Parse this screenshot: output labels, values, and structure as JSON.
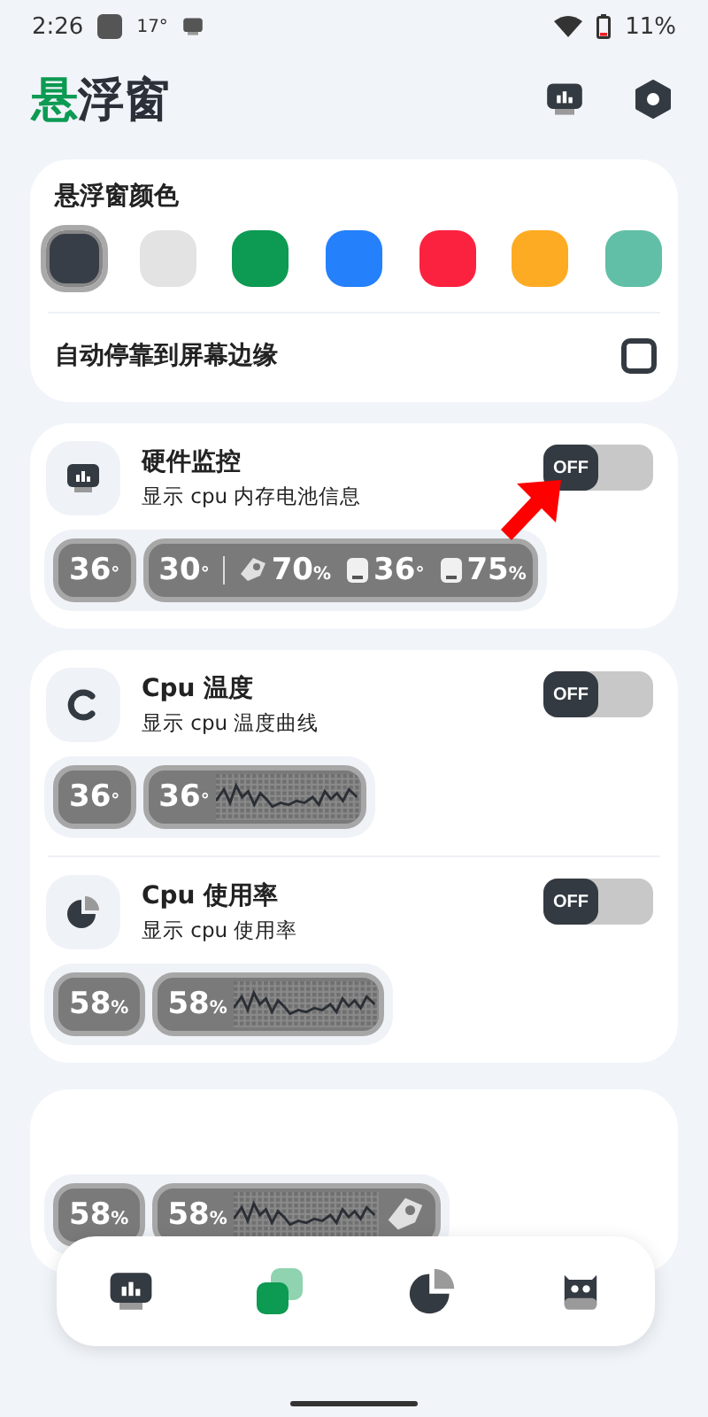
{
  "status_bar": {
    "time": "2:26",
    "temperature": "17°",
    "battery": "11%"
  },
  "header": {
    "title_accent": "悬",
    "title_rest": "浮窗"
  },
  "color_card": {
    "title": "悬浮窗颜色",
    "colors": [
      {
        "color": "#383e47",
        "selected": true
      },
      {
        "color": "#e3e3e3",
        "selected": false
      },
      {
        "color": "#0d9a52",
        "selected": false
      },
      {
        "color": "#2480fb",
        "selected": false
      },
      {
        "color": "#fb2240",
        "selected": false
      },
      {
        "color": "#fdab23",
        "selected": false
      },
      {
        "color": "#62bfa7",
        "selected": false
      }
    ],
    "auto_dock": {
      "label": "自动停靠到屏幕边缘",
      "checked": false
    }
  },
  "monitors": [
    {
      "kind": "hardware",
      "title": "硬件监控",
      "subtitle": "显示 cpu 内存电池信息",
      "toggle": {
        "on": false,
        "label": "OFF"
      },
      "pointer": true,
      "badge": {
        "value": "36",
        "unit": "°"
      },
      "main": {
        "value": "30",
        "unit": "°"
      },
      "stats": [
        {
          "kind": "memory",
          "value": "70",
          "unit": "%"
        },
        {
          "kind": "battery",
          "value": "36",
          "unit": "°"
        },
        {
          "kind": "battery",
          "value": "75",
          "unit": "%"
        }
      ]
    },
    {
      "kind": "cpu_temp",
      "title": "Cpu 温度",
      "subtitle": "显示 cpu 温度曲线",
      "toggle": {
        "on": false,
        "label": "OFF"
      },
      "pointer": false,
      "badge": {
        "value": "36",
        "unit": "°"
      },
      "main": {
        "value": "36",
        "unit": "°"
      }
    },
    {
      "kind": "cpu_usage",
      "title": "Cpu 使用率",
      "subtitle": "显示 cpu 使用率",
      "toggle": {
        "on": false,
        "label": "OFF"
      },
      "pointer": false,
      "badge": {
        "value": "58",
        "unit": "%"
      },
      "main": {
        "value": "58",
        "unit": "%"
      }
    }
  ],
  "memory_card": {
    "badge": {
      "value": "58",
      "unit": "%"
    },
    "main": {
      "value": "58",
      "unit": "%"
    }
  },
  "bottom_nav": [
    {
      "kind": "monitor",
      "selected": false
    },
    {
      "kind": "windows",
      "selected": true
    },
    {
      "kind": "chart",
      "selected": false
    },
    {
      "kind": "robot",
      "selected": false
    }
  ]
}
